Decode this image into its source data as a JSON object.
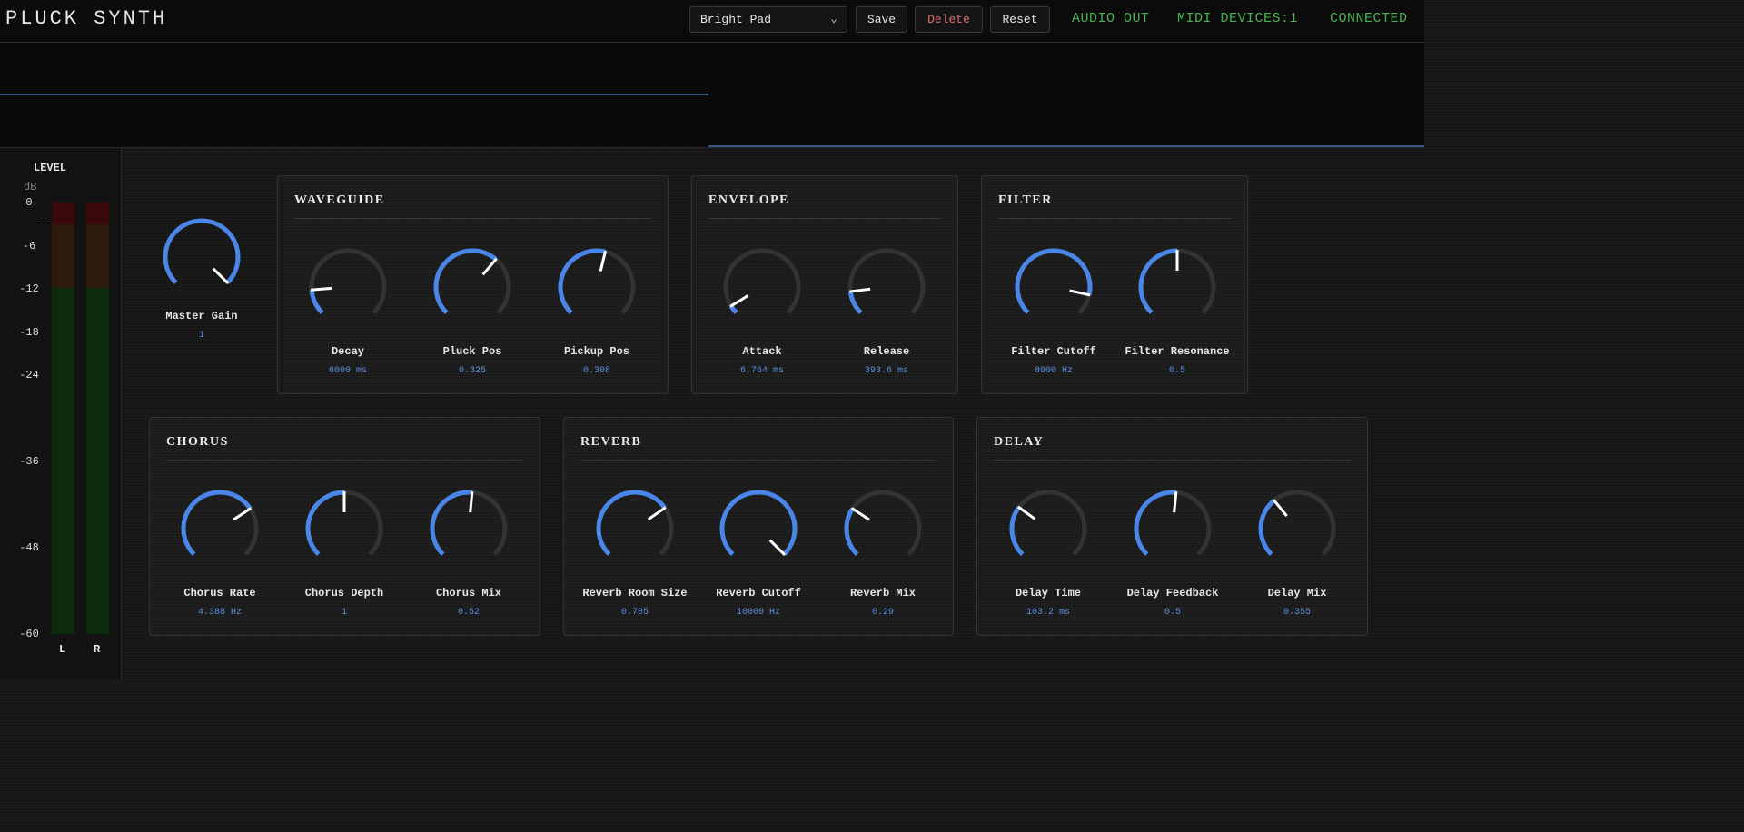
{
  "header": {
    "title": "PLUCK SYNTH",
    "preset": "Bright Pad",
    "save_label": "Save",
    "delete_label": "Delete",
    "reset_label": "Reset",
    "status_audio": "AUDIO OUT",
    "status_midi": "MIDI DEVICES:1",
    "status_connection": "CONNECTED"
  },
  "meter": {
    "title": "LEVEL",
    "unit": "dB",
    "ticks": [
      "0",
      "-6",
      "-12",
      "-18",
      "-24",
      "-36",
      "-48",
      "-60"
    ],
    "left_label": "L",
    "right_label": "R"
  },
  "master": {
    "label": "Master Gain",
    "value": "1",
    "level": 1.0
  },
  "sections": {
    "waveguide": {
      "title": "WAVEGUIDE",
      "knobs": [
        {
          "label": "Decay",
          "value": "6000 ms",
          "level": 0.15
        },
        {
          "label": "Pluck Pos",
          "value": "0.325",
          "level": 0.65
        },
        {
          "label": "Pickup Pos",
          "value": "0.308",
          "level": 0.55
        }
      ]
    },
    "envelope": {
      "title": "ENVELOPE",
      "knobs": [
        {
          "label": "Attack",
          "value": "6.764 ms",
          "level": 0.05
        },
        {
          "label": "Release",
          "value": "393.6 ms",
          "level": 0.14
        }
      ]
    },
    "filter": {
      "title": "FILTER",
      "knobs": [
        {
          "label": "Filter Cutoff",
          "value": "8000 Hz",
          "level": 0.88
        },
        {
          "label": "Filter Resonance",
          "value": "0.5",
          "level": 0.5
        }
      ]
    },
    "chorus": {
      "title": "CHORUS",
      "knobs": [
        {
          "label": "Chorus Rate",
          "value": "4.388 Hz",
          "level": 0.71
        },
        {
          "label": "Chorus Depth",
          "value": "1",
          "level": 0.5
        },
        {
          "label": "Chorus Mix",
          "value": "0.52",
          "level": 0.52
        }
      ]
    },
    "reverb": {
      "title": "REVERB",
      "knobs": [
        {
          "label": "Reverb Room Size",
          "value": "0.705",
          "level": 0.705
        },
        {
          "label": "Reverb Cutoff",
          "value": "10000 Hz",
          "level": 1.0
        },
        {
          "label": "Reverb Mix",
          "value": "0.29",
          "level": 0.29
        }
      ]
    },
    "delay": {
      "title": "DELAY",
      "knobs": [
        {
          "label": "Delay Time",
          "value": "103.2 ms",
          "level": 0.3
        },
        {
          "label": "Delay Feedback",
          "value": "0.5",
          "level": 0.52
        },
        {
          "label": "Delay Mix",
          "value": "0.355",
          "level": 0.355
        }
      ]
    }
  },
  "colors": {
    "accent": "#4a86e8",
    "track": "#333333",
    "status": "#4caf50",
    "delete": "#e07070"
  }
}
